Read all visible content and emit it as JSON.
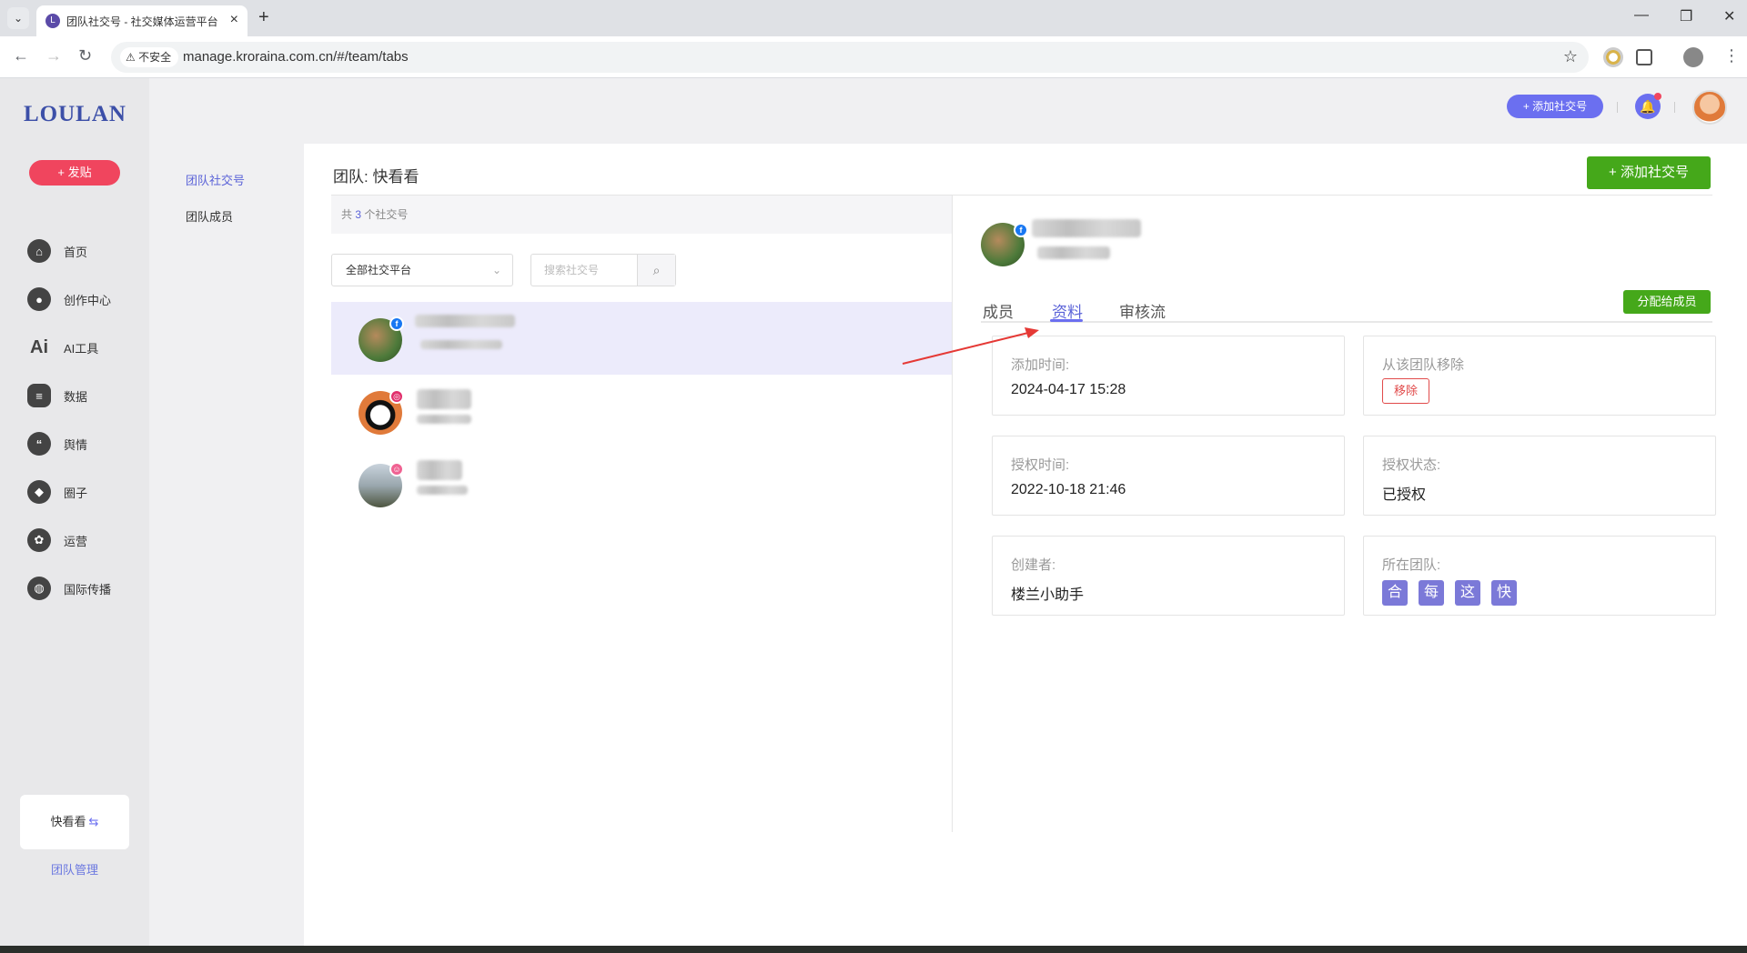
{
  "browser": {
    "tab_title": "团队社交号 - 社交媒体运营平台",
    "insecure_label": "不安全",
    "url": "manage.kroraina.com.cn/#/team/tabs"
  },
  "sidebar": {
    "logo": "LOULAN",
    "post_button": "+ 发贴",
    "items": [
      {
        "label": "首页",
        "icon": "home-icon"
      },
      {
        "label": "创作中心",
        "icon": "palette-icon"
      },
      {
        "label": "AI工具",
        "icon": "ai-icon"
      },
      {
        "label": "数据",
        "icon": "database-icon"
      },
      {
        "label": "舆情",
        "icon": "quote-icon"
      },
      {
        "label": "圈子",
        "icon": "compass-icon"
      },
      {
        "label": "运营",
        "icon": "operations-icon"
      },
      {
        "label": "国际传播",
        "icon": "globe-icon"
      }
    ],
    "current_team": "快看看",
    "team_management": "团队管理"
  },
  "subnav": {
    "items": [
      {
        "label": "团队社交号",
        "active": true
      },
      {
        "label": "团队成员",
        "active": false
      }
    ]
  },
  "topbar": {
    "add_account": "+ 添加社交号"
  },
  "main": {
    "title": "团队: 快看看",
    "add_button": "+ 添加社交号",
    "count_prefix": "共",
    "count": "3",
    "count_suffix": "个社交号",
    "platform_select": "全部社交平台",
    "search_placeholder": "搜索社交号",
    "accounts": [
      {
        "platform": "facebook",
        "badge_color": "#1877f2",
        "selected": true
      },
      {
        "platform": "instagram",
        "badge_color": "#e1306c",
        "selected": false
      },
      {
        "platform": "other",
        "badge_color": "#f06292",
        "selected": false
      }
    ]
  },
  "detail": {
    "tabs": [
      "成员",
      "资料",
      "审核流"
    ],
    "active_tab": "资料",
    "assign_button": "分配给成员",
    "cards": {
      "added_label": "添加时间:",
      "added_value": "2024-04-17 15:28",
      "remove_label": "从该团队移除",
      "remove_button": "移除",
      "auth_time_label": "授权时间:",
      "auth_time_value": "2022-10-18 21:46",
      "auth_status_label": "授权状态:",
      "auth_status_value": "已授权",
      "creator_label": "创建者:",
      "creator_value": "楼兰小助手",
      "teams_label": "所在团队:",
      "teams": [
        "合",
        "每",
        "这",
        "快"
      ]
    }
  },
  "colors": {
    "accent": "#6b6ff0",
    "green": "#45a81a",
    "red": "#f0455e"
  }
}
